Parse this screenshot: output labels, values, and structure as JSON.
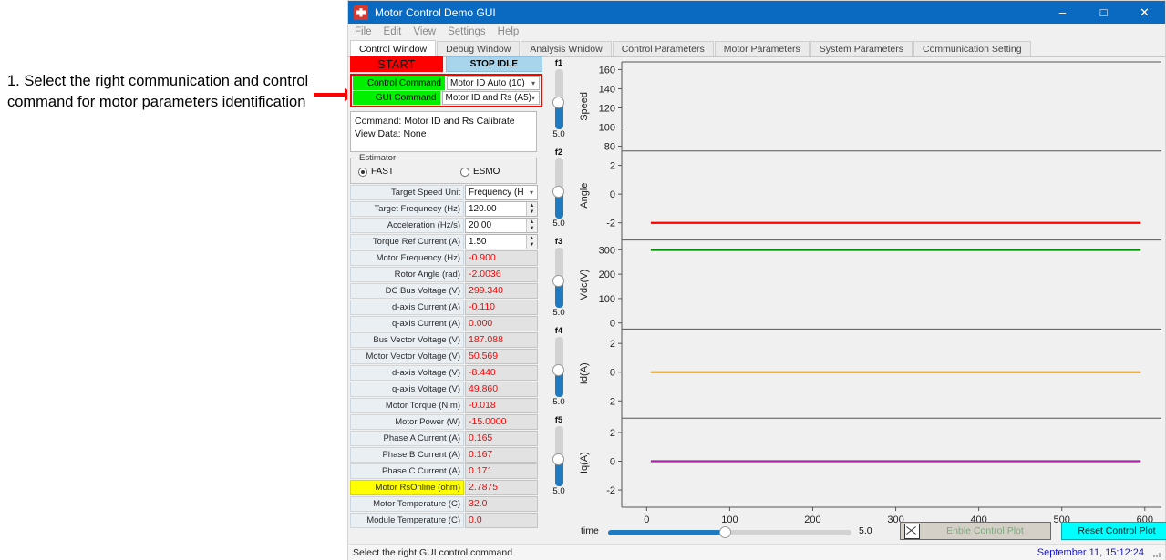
{
  "annotation": {
    "text": "1. Select the right communication and control command for motor parameters identification",
    "arrow_color": "#ff0000"
  },
  "window": {
    "title": "Motor Control Demo GUI",
    "icon": "app-icon",
    "minimize": "–",
    "maximize": "□",
    "close": "✕",
    "titlebar_color": "#0a6ac1"
  },
  "menu": {
    "items": [
      "File",
      "Edit",
      "View",
      "Settings",
      "Help"
    ]
  },
  "tabs": {
    "active": "Control Window",
    "items": [
      "Control Window",
      "Debug Window",
      "Analysis Wnidow",
      "Control Parameters",
      "Motor Parameters",
      "System Parameters",
      "Communication Setting"
    ]
  },
  "controls": {
    "start_label": "START",
    "stop_label": "STOP IDLE",
    "control_command_label": "Control Command",
    "control_command_value": "Motor ID Auto (10)",
    "gui_command_label": "GUI Command",
    "gui_command_value": "Motor ID and Rs (A5)",
    "status_line1": "Command: Motor ID and Rs Calibrate",
    "status_line2": "View Data: None",
    "estimator_legend": "Estimator",
    "estimator_fast": "FAST",
    "estimator_esmo": "ESMO",
    "estimator_selected": "FAST"
  },
  "params": [
    {
      "label": "Target Speed Unit",
      "value": "Frequency (H",
      "type": "dropdown"
    },
    {
      "label": "Target Frequnecy (Hz)",
      "value": "120.00",
      "type": "spinner"
    },
    {
      "label": "Acceleration (Hz/s)",
      "value": "20.00",
      "type": "spinner"
    },
    {
      "label": "Torque Ref Current (A)",
      "value": "1.50",
      "type": "spinner"
    }
  ],
  "monitors": [
    {
      "label": "Motor Frequency (Hz)",
      "value": "-0.900",
      "highlight": false
    },
    {
      "label": "Rotor Angle (rad)",
      "value": "-2.0036",
      "highlight": false
    },
    {
      "label": "DC Bus Voltage (V)",
      "value": "299.340",
      "highlight": false
    },
    {
      "label": "d-axis Current (A)",
      "value": "-0.110",
      "highlight": false
    },
    {
      "label": "q-axis Current (A)",
      "value": "0.000",
      "highlight": false
    },
    {
      "label": "Bus Vector Voltage (V)",
      "value": "187.088",
      "highlight": false
    },
    {
      "label": "Motor Vector Voltage (V)",
      "value": "50.569",
      "highlight": false
    },
    {
      "label": "d-axis Voltage (V)",
      "value": "-8.440",
      "highlight": false
    },
    {
      "label": "q-axis Voltage (V)",
      "value": "49.860",
      "highlight": false
    },
    {
      "label": "Motor Torque (N.m)",
      "value": "-0.018",
      "highlight": false
    },
    {
      "label": "Motor Power (W)",
      "value": "-15.0000",
      "highlight": false
    },
    {
      "label": "Phase A Current (A)",
      "value": "0.165",
      "highlight": false
    },
    {
      "label": "Phase B Current (A)",
      "value": "0.167",
      "highlight": false
    },
    {
      "label": "Phase C Current (A)",
      "value": "0.171",
      "highlight": false
    },
    {
      "label": "Motor RsOnline (ohm)",
      "value": "2.7875",
      "highlight": true
    },
    {
      "label": "Motor Temperature (C)",
      "value": "32.0",
      "highlight": false
    },
    {
      "label": "Module Temperature (C)",
      "value": "0.0",
      "highlight": false
    }
  ],
  "sliders": [
    {
      "name": "f1",
      "value": "5.0"
    },
    {
      "name": "f2",
      "value": "5.0"
    },
    {
      "name": "f3",
      "value": "5.0"
    },
    {
      "name": "f4",
      "value": "5.0"
    },
    {
      "name": "f5",
      "value": "5.0"
    }
  ],
  "bottom": {
    "time_label": "time",
    "time_value": "5.0",
    "enable_plot_label": "Enble Control Plot",
    "reset_plot_label": "Reset Control Plot",
    "enable_plot_checked": true
  },
  "statusbar": {
    "message": "Select the right GUI control command",
    "datetime": "September 11, 15:12:24"
  },
  "chart_data": {
    "type": "line",
    "title": "",
    "xlabel": "",
    "xlim": [
      -30,
      620
    ],
    "xticks": [
      0,
      100,
      200,
      300,
      400,
      500,
      600
    ],
    "grid": false,
    "legend": "none",
    "subplots": [
      {
        "ylabel": "Speed",
        "ylim": [
          75,
          168
        ],
        "yticks": [
          80,
          100,
          120,
          140,
          160
        ],
        "series": [
          {
            "name": "Speed",
            "color": "#1f77b4",
            "values": []
          }
        ]
      },
      {
        "ylabel": "Angle",
        "ylim": [
          -3.2,
          3.0
        ],
        "yticks": [
          -2,
          0,
          2
        ],
        "series": [
          {
            "name": "Angle",
            "color": "#ff0000",
            "x": [
              5,
              595
            ],
            "values": [
              -2.0036,
              -2.0036
            ]
          }
        ]
      },
      {
        "ylabel": "Vdc(V)",
        "ylim": [
          -25,
          340
        ],
        "yticks": [
          0,
          100,
          200,
          300
        ],
        "series": [
          {
            "name": "Vdc",
            "color": "#009000",
            "x": [
              5,
              595
            ],
            "values": [
              299.34,
              299.34
            ]
          }
        ]
      },
      {
        "ylabel": "Id(A)",
        "ylim": [
          -3.2,
          3.0
        ],
        "yticks": [
          -2,
          0,
          2
        ],
        "series": [
          {
            "name": "Id",
            "color": "#f5a623",
            "x": [
              5,
              595
            ],
            "values": [
              0,
              0
            ]
          }
        ]
      },
      {
        "ylabel": "Iq(A)",
        "ylim": [
          -3.2,
          3.0
        ],
        "yticks": [
          -2,
          0,
          2
        ],
        "series": [
          {
            "name": "Iq",
            "color": "#a626a6",
            "x": [
              5,
              595
            ],
            "values": [
              0,
              0
            ]
          }
        ]
      }
    ]
  }
}
